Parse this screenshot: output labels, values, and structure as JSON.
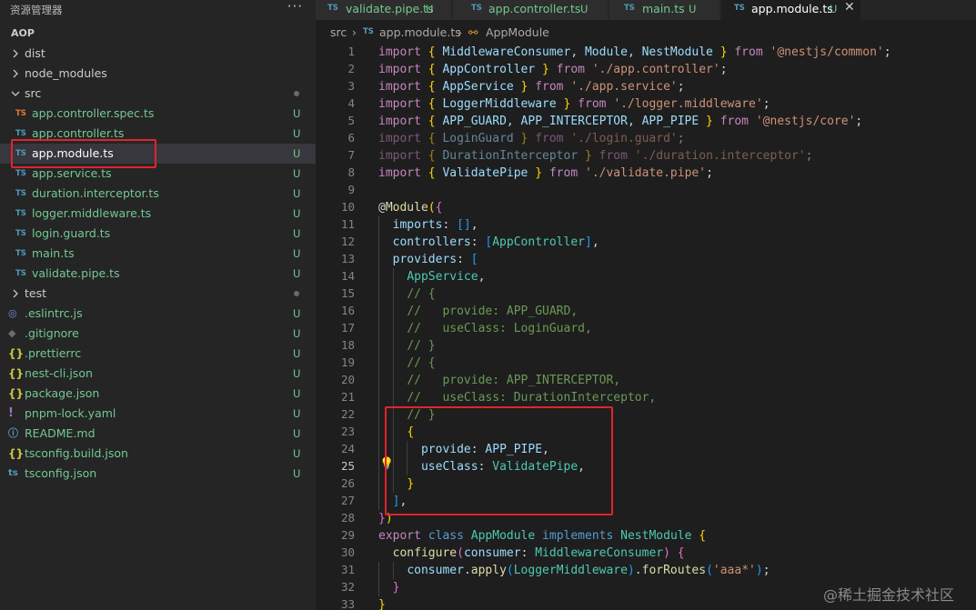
{
  "explorer": {
    "title": "资源管理器",
    "more": "···",
    "project": "AOP"
  },
  "tree": [
    {
      "label": "dist",
      "kind": "folder-closed",
      "level": 0,
      "status": ""
    },
    {
      "label": "node_modules",
      "kind": "folder-closed",
      "level": 0,
      "status": ""
    },
    {
      "label": "src",
      "kind": "folder-open",
      "level": 0,
      "status": "dot"
    },
    {
      "label": "app.controller.spec.ts",
      "kind": "ts-spec",
      "level": 1,
      "status": "U"
    },
    {
      "label": "app.controller.ts",
      "kind": "ts",
      "level": 1,
      "status": "U"
    },
    {
      "label": "app.module.ts",
      "kind": "ts",
      "level": 1,
      "status": "U",
      "selected": true
    },
    {
      "label": "app.service.ts",
      "kind": "ts",
      "level": 1,
      "status": "U"
    },
    {
      "label": "duration.interceptor.ts",
      "kind": "ts",
      "level": 1,
      "status": "U"
    },
    {
      "label": "logger.middleware.ts",
      "kind": "ts",
      "level": 1,
      "status": "U"
    },
    {
      "label": "login.guard.ts",
      "kind": "ts",
      "level": 1,
      "status": "U"
    },
    {
      "label": "main.ts",
      "kind": "ts",
      "level": 1,
      "status": "U"
    },
    {
      "label": "validate.pipe.ts",
      "kind": "ts",
      "level": 1,
      "status": "U"
    },
    {
      "label": "test",
      "kind": "folder-closed",
      "level": 0,
      "status": "dot"
    },
    {
      "label": ".eslintrc.js",
      "kind": "eslint",
      "level": 0,
      "status": "U"
    },
    {
      "label": ".gitignore",
      "kind": "git",
      "level": 0,
      "status": "U"
    },
    {
      "label": ".prettierrc",
      "kind": "json",
      "level": 0,
      "status": "U"
    },
    {
      "label": "nest-cli.json",
      "kind": "json",
      "level": 0,
      "status": "U"
    },
    {
      "label": "package.json",
      "kind": "json",
      "level": 0,
      "status": "U"
    },
    {
      "label": "pnpm-lock.yaml",
      "kind": "yaml",
      "level": 0,
      "status": "U"
    },
    {
      "label": "README.md",
      "kind": "md",
      "level": 0,
      "status": "U"
    },
    {
      "label": "tsconfig.build.json",
      "kind": "json",
      "level": 0,
      "status": "U"
    },
    {
      "label": "tsconfig.json",
      "kind": "tsconfig",
      "level": 0,
      "status": "U"
    }
  ],
  "icons": {
    "ts": "TS",
    "json": "{}",
    "yaml": "!",
    "md": "ⓘ",
    "git": "◆",
    "eslint": "◎",
    "tsconfig": "ts"
  },
  "tabs": [
    {
      "label": "validate.pipe.ts",
      "badge": "U",
      "icon": "TS",
      "active": false
    },
    {
      "label": "app.controller.ts",
      "badge": "U",
      "icon": "TS",
      "active": false
    },
    {
      "label": "main.ts",
      "badge": "U",
      "icon": "TS",
      "active": false
    },
    {
      "label": "app.module.ts",
      "badge": "U",
      "icon": "TS",
      "active": true,
      "close": "✕"
    }
  ],
  "breadcrumb": {
    "folder": "src",
    "sep1": "›",
    "file_icon": "TS",
    "file": "app.module.ts",
    "sep2": "›",
    "symbol_icon": "⚯",
    "symbol": "AppModule"
  },
  "editor": {
    "current_line": 25,
    "lines": [
      [
        [
          "import",
          "k"
        ],
        [
          " ",
          "p"
        ],
        [
          "{",
          "b1"
        ],
        [
          " MiddlewareConsumer, Module, NestModule ",
          "v"
        ],
        [
          "}",
          "b1"
        ],
        [
          " ",
          "p"
        ],
        [
          "from",
          "k"
        ],
        [
          " ",
          "p"
        ],
        [
          "'@nestjs/common'",
          "s"
        ],
        [
          ";",
          "p"
        ]
      ],
      [
        [
          "import",
          "k"
        ],
        [
          " ",
          "p"
        ],
        [
          "{",
          "b1"
        ],
        [
          " AppController ",
          "v"
        ],
        [
          "}",
          "b1"
        ],
        [
          " ",
          "p"
        ],
        [
          "from",
          "k"
        ],
        [
          " ",
          "p"
        ],
        [
          "'./app.controller'",
          "s"
        ],
        [
          ";",
          "p"
        ]
      ],
      [
        [
          "import",
          "k"
        ],
        [
          " ",
          "p"
        ],
        [
          "{",
          "b1"
        ],
        [
          " AppService ",
          "v"
        ],
        [
          "}",
          "b1"
        ],
        [
          " ",
          "p"
        ],
        [
          "from",
          "k"
        ],
        [
          " ",
          "p"
        ],
        [
          "'./app.service'",
          "s"
        ],
        [
          ";",
          "p"
        ]
      ],
      [
        [
          "import",
          "k"
        ],
        [
          " ",
          "p"
        ],
        [
          "{",
          "b1"
        ],
        [
          " LoggerMiddleware ",
          "v"
        ],
        [
          "}",
          "b1"
        ],
        [
          " ",
          "p"
        ],
        [
          "from",
          "k"
        ],
        [
          " ",
          "p"
        ],
        [
          "'./logger.middleware'",
          "s"
        ],
        [
          ";",
          "p"
        ]
      ],
      [
        [
          "import",
          "k"
        ],
        [
          " ",
          "p"
        ],
        [
          "{",
          "b1"
        ],
        [
          " APP_GUARD, APP_INTERCEPTOR, APP_PIPE ",
          "v"
        ],
        [
          "}",
          "b1"
        ],
        [
          " ",
          "p"
        ],
        [
          "from",
          "k"
        ],
        [
          " ",
          "p"
        ],
        [
          "'@nestjs/core'",
          "s"
        ],
        [
          ";",
          "p"
        ]
      ],
      [
        [
          "import { LoginGuard } from './login.guard';",
          "dimline"
        ]
      ],
      [
        [
          "import { DurationInterceptor } from './duration.interceptor';",
          "dimline"
        ]
      ],
      [
        [
          "import",
          "k"
        ],
        [
          " ",
          "p"
        ],
        [
          "{",
          "b1"
        ],
        [
          " ValidatePipe ",
          "v"
        ],
        [
          "}",
          "b1"
        ],
        [
          " ",
          "p"
        ],
        [
          "from",
          "k"
        ],
        [
          " ",
          "p"
        ],
        [
          "'./validate.pipe'",
          "s"
        ],
        [
          ";",
          "p"
        ]
      ],
      [],
      [
        [
          "@",
          "p"
        ],
        [
          "Module",
          "f"
        ],
        [
          "(",
          "b1"
        ],
        [
          "{",
          "b2"
        ]
      ],
      [
        [
          "  ",
          "p"
        ],
        [
          "imports",
          "v"
        ],
        [
          ": ",
          "p"
        ],
        [
          "[]",
          "b3"
        ],
        [
          ",",
          "p"
        ]
      ],
      [
        [
          "  ",
          "p"
        ],
        [
          "controllers",
          "v"
        ],
        [
          ": ",
          "p"
        ],
        [
          "[",
          "b3"
        ],
        [
          "AppController",
          "t"
        ],
        [
          "]",
          "b3"
        ],
        [
          ",",
          "p"
        ]
      ],
      [
        [
          "  ",
          "p"
        ],
        [
          "providers",
          "v"
        ],
        [
          ": ",
          "p"
        ],
        [
          "[",
          "b3"
        ]
      ],
      [
        [
          "    ",
          "p"
        ],
        [
          "AppService",
          "t"
        ],
        [
          ",",
          "p"
        ]
      ],
      [
        [
          "    ",
          "p"
        ],
        [
          "// {",
          "c"
        ]
      ],
      [
        [
          "    ",
          "p"
        ],
        [
          "//   provide: APP_GUARD,",
          "c"
        ]
      ],
      [
        [
          "    ",
          "p"
        ],
        [
          "//   useClass: LoginGuard,",
          "c"
        ]
      ],
      [
        [
          "    ",
          "p"
        ],
        [
          "// }",
          "c"
        ]
      ],
      [
        [
          "    ",
          "p"
        ],
        [
          "// {",
          "c"
        ]
      ],
      [
        [
          "    ",
          "p"
        ],
        [
          "//   provide: APP_INTERCEPTOR,",
          "c"
        ]
      ],
      [
        [
          "    ",
          "p"
        ],
        [
          "//   useClass: DurationInterceptor,",
          "c"
        ]
      ],
      [
        [
          "    ",
          "p"
        ],
        [
          "// }",
          "c"
        ]
      ],
      [
        [
          "    ",
          "p"
        ],
        [
          "{",
          "b1"
        ]
      ],
      [
        [
          "      ",
          "p"
        ],
        [
          "provide",
          "v"
        ],
        [
          ": ",
          "p"
        ],
        [
          "APP_PIPE",
          "v"
        ],
        [
          ",",
          "p"
        ]
      ],
      [
        [
          "      ",
          "p"
        ],
        [
          "useClass",
          "v"
        ],
        [
          ": ",
          "p"
        ],
        [
          "ValidatePipe",
          "t"
        ],
        [
          ",",
          "p"
        ]
      ],
      [
        [
          "    ",
          "p"
        ],
        [
          "}",
          "b1"
        ]
      ],
      [
        [
          "  ",
          "p"
        ],
        [
          "]",
          "b3"
        ],
        [
          ",",
          "p"
        ]
      ],
      [
        [
          "}",
          "b2"
        ],
        [
          ")",
          "b1"
        ]
      ],
      [
        [
          "export",
          "k"
        ],
        [
          " ",
          "p"
        ],
        [
          "class",
          "kb"
        ],
        [
          " ",
          "p"
        ],
        [
          "AppModule",
          "t"
        ],
        [
          " ",
          "p"
        ],
        [
          "implements",
          "kb"
        ],
        [
          " ",
          "p"
        ],
        [
          "NestModule",
          "t"
        ],
        [
          " ",
          "p"
        ],
        [
          "{",
          "b1"
        ]
      ],
      [
        [
          "  ",
          "p"
        ],
        [
          "configure",
          "f"
        ],
        [
          "(",
          "b2"
        ],
        [
          "consumer",
          "v"
        ],
        [
          ": ",
          "p"
        ],
        [
          "MiddlewareConsumer",
          "t"
        ],
        [
          ")",
          "b2"
        ],
        [
          " ",
          "p"
        ],
        [
          "{",
          "b2"
        ]
      ],
      [
        [
          "    ",
          "p"
        ],
        [
          "consumer",
          "v"
        ],
        [
          ".",
          "p"
        ],
        [
          "apply",
          "f"
        ],
        [
          "(",
          "b3"
        ],
        [
          "LoggerMiddleware",
          "t"
        ],
        [
          ")",
          "b3"
        ],
        [
          ".",
          "p"
        ],
        [
          "forRoutes",
          "f"
        ],
        [
          "(",
          "b3"
        ],
        [
          "'aaa*'",
          "s"
        ],
        [
          ")",
          "b3"
        ],
        [
          ";",
          "p"
        ]
      ],
      [
        [
          "  ",
          "p"
        ],
        [
          "}",
          "b2"
        ]
      ],
      [
        [
          "}",
          "b1"
        ]
      ]
    ]
  },
  "watermark": "@稀土掘金技术社区"
}
